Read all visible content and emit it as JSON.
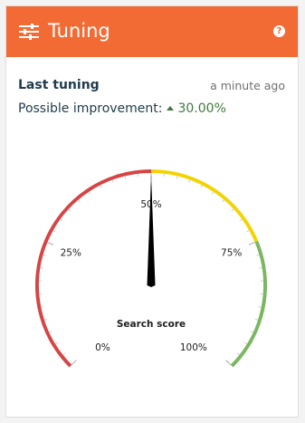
{
  "header": {
    "title": "Tuning",
    "help_icon": "?",
    "background": "#f36b34"
  },
  "last_tuning": {
    "label": "Last tuning",
    "time": "a minute ago"
  },
  "improvement": {
    "label": "Possible improvement:",
    "value": "30.00%",
    "trend_icon": "triangle-up-icon",
    "color": "#3e7a3c"
  },
  "gauge": {
    "title": "Search score",
    "value_percent": 50,
    "ticks": [
      "0%",
      "25%",
      "50%",
      "75%",
      "100%"
    ],
    "zone_colors": [
      "#d64545",
      "#f2d400",
      "#7bb661"
    ]
  }
}
